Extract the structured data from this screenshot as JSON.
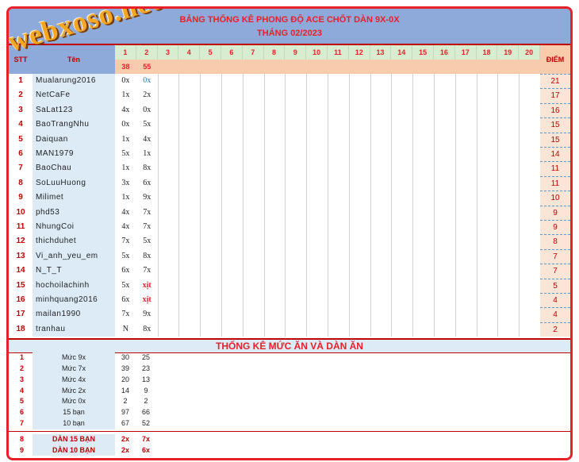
{
  "header": {
    "title": "BẢNG THỐNG KÊ PHONG ĐỘ ACE CHỐT DÀN 9X-0X",
    "month": "THÁNG 02/2023",
    "watermark": "webxoso.net"
  },
  "columns": {
    "stt": "STT",
    "name": "Tên",
    "points": "ĐIỂM",
    "days": [
      "1",
      "2",
      "3",
      "4",
      "5",
      "6",
      "7",
      "8",
      "9",
      "10",
      "11",
      "12",
      "13",
      "14",
      "15",
      "16",
      "17",
      "18",
      "19",
      "20"
    ],
    "day_counts": [
      "38",
      "55"
    ]
  },
  "players": [
    {
      "stt": "1",
      "name": "Mualarung2016",
      "d1": "0x",
      "d2": "0x",
      "points": "21"
    },
    {
      "stt": "2",
      "name": "NetCaFe",
      "d1": "1x",
      "d2": "2x",
      "points": "17"
    },
    {
      "stt": "3",
      "name": "SaLat123",
      "d1": "4x",
      "d2": "0x",
      "points": "16"
    },
    {
      "stt": "4",
      "name": "BaoTrangNhu",
      "d1": "0x",
      "d2": "5x",
      "points": "15"
    },
    {
      "stt": "5",
      "name": "Daiquan",
      "d1": "1x",
      "d2": "4x",
      "points": "15"
    },
    {
      "stt": "6",
      "name": "MAN1979",
      "d1": "5x",
      "d2": "1x",
      "points": "14"
    },
    {
      "stt": "7",
      "name": "BaoChau",
      "d1": "1x",
      "d2": "8x",
      "points": "11"
    },
    {
      "stt": "8",
      "name": "SoLuuHuong",
      "d1": "3x",
      "d2": "6x",
      "points": "11"
    },
    {
      "stt": "9",
      "name": "Milimet",
      "d1": "1x",
      "d2": "9x",
      "points": "10"
    },
    {
      "stt": "10",
      "name": "phd53",
      "d1": "4x",
      "d2": "7x",
      "points": "9"
    },
    {
      "stt": "11",
      "name": "NhungCoi",
      "d1": "4x",
      "d2": "7x",
      "points": "9"
    },
    {
      "stt": "12",
      "name": "thichduhet",
      "d1": "7x",
      "d2": "5x",
      "points": "8"
    },
    {
      "stt": "13",
      "name": "Vi_anh_yeu_em",
      "d1": "5x",
      "d2": "8x",
      "points": "7"
    },
    {
      "stt": "14",
      "name": "N_T_T",
      "d1": "6x",
      "d2": "7x",
      "points": "7"
    },
    {
      "stt": "15",
      "name": "hochoilachinh",
      "d1": "5x",
      "d2": "xịt",
      "points": "5"
    },
    {
      "stt": "16",
      "name": "minhquang2016",
      "d1": "6x",
      "d2": "xịt",
      "points": "4"
    },
    {
      "stt": "17",
      "name": "mailan1990",
      "d1": "7x",
      "d2": "9x",
      "points": "4"
    },
    {
      "stt": "18",
      "name": "tranhau",
      "d1": "N",
      "d2": "8x",
      "points": "2"
    }
  ],
  "summary": {
    "title": "THỐNG KÊ MỨC ĂN VÀ DÀN ĂN",
    "rows": [
      {
        "stt": "1",
        "label": "Mức 9x",
        "d1": "30",
        "d2": "25"
      },
      {
        "stt": "2",
        "label": "Mức 7x",
        "d1": "39",
        "d2": "23"
      },
      {
        "stt": "3",
        "label": "Mức 4x",
        "d1": "20",
        "d2": "13"
      },
      {
        "stt": "4",
        "label": "Mức 2x",
        "d1": "14",
        "d2": "9"
      },
      {
        "stt": "5",
        "label": "Mức 0x",
        "d1": "2",
        "d2": "2"
      },
      {
        "stt": "6",
        "label": "15 bạn",
        "d1": "97",
        "d2": "66"
      },
      {
        "stt": "7",
        "label": "10 bạn",
        "d1": "67",
        "d2": "52"
      },
      {
        "stt": "8",
        "label": "DÀN 15 BẠN",
        "d1": "2x",
        "d2": "7x"
      },
      {
        "stt": "9",
        "label": "DÀN 10 BẠN",
        "d1": "2x",
        "d2": "6x"
      }
    ]
  },
  "colors": {
    "accent": "#e8202a",
    "header_band": "#8eaadb",
    "name_bg": "#ddebf7",
    "points_bg": "#fbe5d6"
  }
}
